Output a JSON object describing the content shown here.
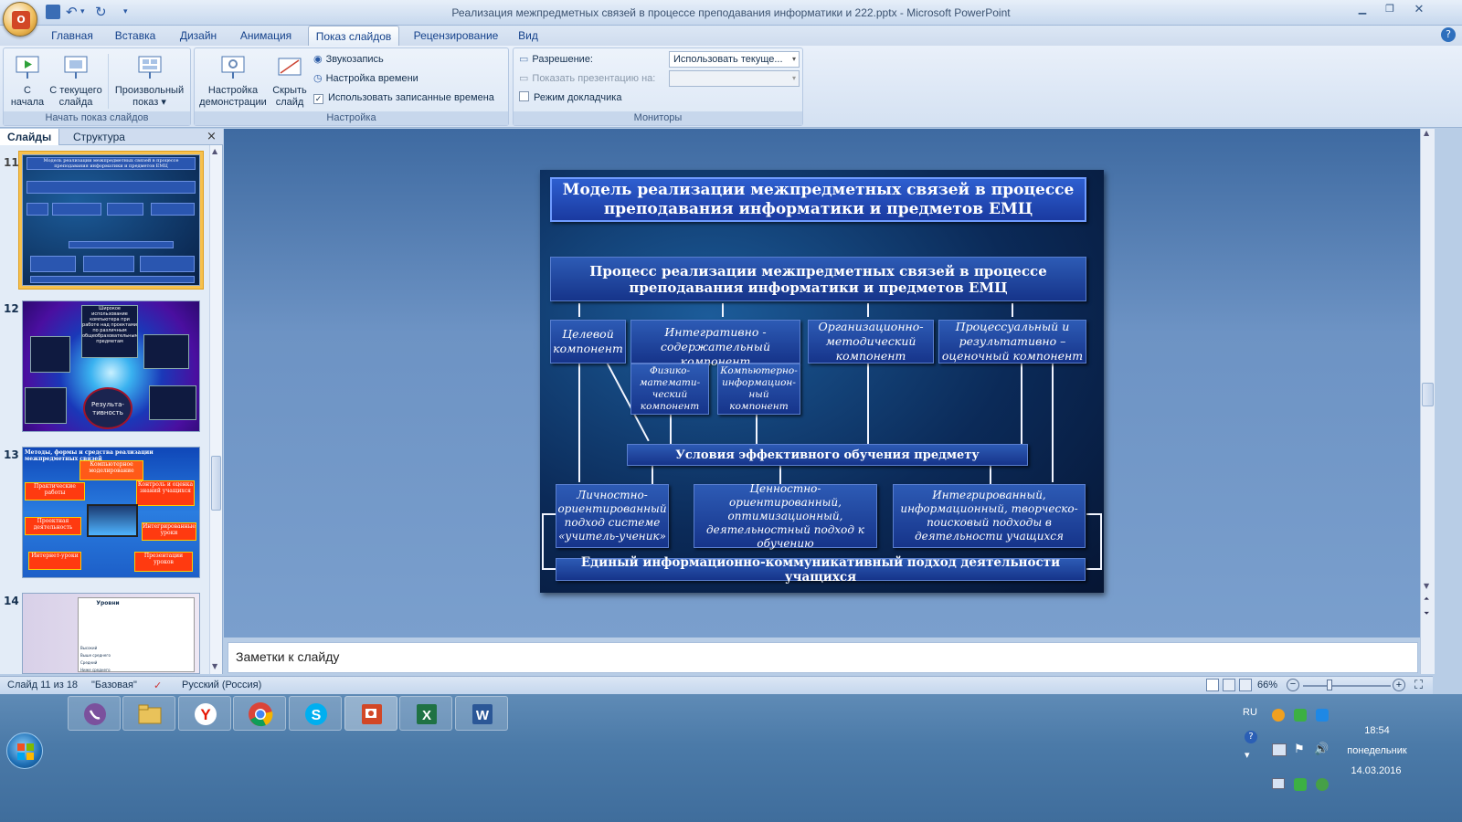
{
  "window": {
    "title": "Реализация межпредметных связей в процессе преподавания информатики и  222.pptx - Microsoft PowerPoint",
    "office_button_logo": "O"
  },
  "tabs": [
    "Главная",
    "Вставка",
    "Дизайн",
    "Анимация",
    "Показ слайдов",
    "Рецензирование",
    "Вид"
  ],
  "active_tab": "Показ слайдов",
  "ribbon": {
    "group1": {
      "label": "Начать показ слайдов",
      "btn_start_begin": "С\nначала",
      "btn_start_begin_l1": "С",
      "btn_start_begin_l2": "начала",
      "btn_current_l1": "С текущего",
      "btn_current_l2": "слайда",
      "btn_custom_l1": "Произвольный",
      "btn_custom_l2": "показ ▾"
    },
    "group2": {
      "label": "Настройка",
      "btn_setup_l1": "Настройка",
      "btn_setup_l2": "демонстрации",
      "btn_hide_l1": "Скрыть",
      "btn_hide_l2": "слайд",
      "record": "Звукозапись",
      "timing": "Настройка времени",
      "use_timings": "Использовать записанные времена"
    },
    "group3": {
      "label": "Мониторы",
      "resolution_label": "Разрешение:",
      "resolution_value": "Использовать текуще...",
      "show_on_label": "Показать презентацию на:",
      "presenter_view": "Режим докладчика"
    }
  },
  "left_pane": {
    "tab_slides": "Слайды",
    "tab_outline": "Структура",
    "close": "×",
    "slides": [
      {
        "num": "11"
      },
      {
        "num": "12"
      },
      {
        "num": "13"
      },
      {
        "num": "14"
      }
    ],
    "thumb11": {
      "title": "Модель реализации межпредметных связей в процессе преподавания информатики и предметов ЕМЦ"
    },
    "thumb12": {
      "center": "Результа-тивность",
      "top_box": "Широкое использование компьютера при работе над проектами по различным общеобразовательным предметам"
    },
    "thumb13": {
      "title": "Методы, формы и средства реализации межпредметных связей",
      "items": [
        "Компьютерное моделирование",
        "Практические работы",
        "Контроль и оценка знаний учащихся",
        "Проектная деятельность",
        "Интегрированные уроки",
        "Интернет-уроки",
        "Презентации уроков"
      ]
    },
    "thumb14": {
      "header": "Уровни",
      "rows": [
        "Высокий",
        "Выше среднего",
        "Средний",
        "Ниже среднего"
      ]
    }
  },
  "slide": {
    "title": "Модель реализации межпредметных связей в процессе преподавания информатики и предметов ЕМЦ",
    "process": "Процесс реализации межпредметных связей в процессе преподавания информатики и предметов ЕМЦ",
    "target": "Целевой компонент",
    "integrative": "Интегративно - содержательный компонент",
    "org_method": "Организационно-методический компонент",
    "procedural": "Процессуальный и результативно – оценочный компонент",
    "physmath": "Физико-математи-ческий компонент",
    "compinfo": "Компьютерно-информацион-ный компонент",
    "conditions": "Условия эффективного обучения предмету",
    "personal": "Личностно-ориентированный подход системе «учитель-ученик»",
    "value": "Ценностно-ориентированный, оптимизационный, деятельностный подход к обучению",
    "integrated": "Интегрированный, информационный, творческо-поисковый подходы в деятельности учащихся",
    "unified": "Единый информационно-коммуникативный подход деятельности учащихся"
  },
  "notes": {
    "placeholder": "Заметки к слайду"
  },
  "status": {
    "slide_counter": "Слайд 11 из 18",
    "theme": "\"Базовая\"",
    "language": "Русский (Россия)",
    "zoom": "66%"
  },
  "taskbar": {
    "apps": [
      "viber-icon",
      "explorer-icon",
      "yandex-icon",
      "chrome-icon",
      "skype-icon",
      "powerpoint-icon",
      "excel-icon",
      "word-icon"
    ],
    "lang": "RU",
    "time": "18:54",
    "day": "понедельник",
    "date": "14.03.2016"
  },
  "colors": {
    "slide_bg": "#0b2a58",
    "box_fill": "#1f45a3",
    "ribbon": "#dce7f5",
    "taskbar": "#4b7aa8"
  }
}
